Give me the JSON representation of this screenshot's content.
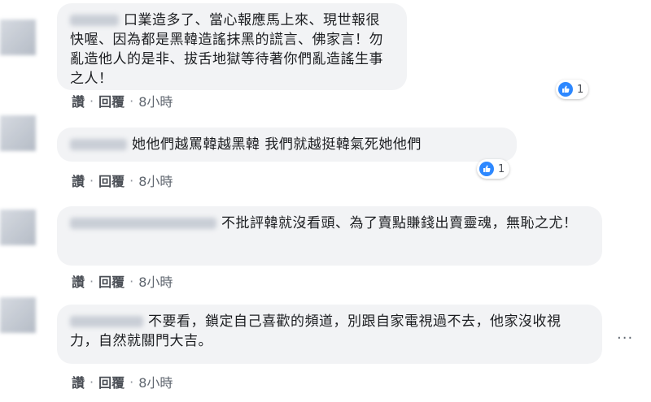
{
  "comments": [
    {
      "text": "口業造多了、當心報應馬上來、現世報很快喔、因為都是黑韓造謠抹黑的謊言、佛家言！勿亂造他人的是非、拔舌地獄等待著你們亂造謠生事之人！",
      "like_label": "讚",
      "reply_label": "回覆",
      "time": "8小時",
      "reaction_count": "1"
    },
    {
      "text": "她他們越罵韓越黑韓 我們就越挺韓氣死她他們",
      "like_label": "讚",
      "reply_label": "回覆",
      "time": "8小時",
      "reaction_count": "1"
    },
    {
      "text": "不批評韓就沒看頭、為了賣點賺錢出賣靈魂，無恥之尤！",
      "like_label": "讚",
      "reply_label": "回覆",
      "time": "8小時"
    },
    {
      "text": "不要看，鎖定自己喜歡的頻道，別跟自家電視過不去，他家沒收視力，自然就關門大吉。",
      "like_label": "讚",
      "reply_label": "回覆",
      "time": "8小時"
    }
  ],
  "separator": "·",
  "icons": {
    "reaction": "like-icon",
    "more": "more-options-icon"
  },
  "colors": {
    "bubble": "#f2f3f5",
    "like": "#2d88ff",
    "text": "#1c1e21",
    "action": "#4b4f56"
  }
}
